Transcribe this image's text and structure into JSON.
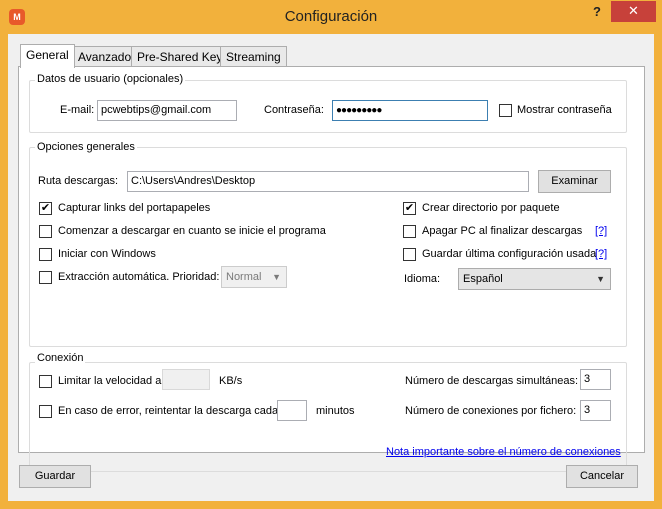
{
  "window": {
    "title": "Configuración",
    "app_icon": "M",
    "help_label": "?",
    "close_label": "✕"
  },
  "tabs": [
    {
      "label": "General"
    },
    {
      "label": "Avanzado"
    },
    {
      "label": "Pre-Shared Keys"
    },
    {
      "label": "Streaming"
    }
  ],
  "user": {
    "legend": "Datos de usuario (opcionales)",
    "email_label": "E-mail:",
    "email_value": "pcwebtips@gmail.com",
    "password_label": "Contraseña:",
    "password_value": "●●●●●●●●●",
    "show_password_label": "Mostrar contraseña"
  },
  "general": {
    "legend": "Opciones generales",
    "download_path_label": "Ruta descargas:",
    "download_path_value": "C:\\Users\\Andres\\Desktop",
    "browse_label": "Examinar",
    "capture_label": "Capturar links del portapapeles",
    "start_label": "Comenzar a descargar en cuanto se inicie el programa",
    "windows_label": "Iniciar con Windows",
    "extract_label": "Extracción automática. Prioridad:",
    "priority_value": "Normal",
    "create_dir_label": "Crear directorio por paquete",
    "shutdown_label": "Apagar PC al finalizar descargas",
    "save_config_label": "Guardar última configuración usada",
    "help_link": "[?]",
    "language_label": "Idioma:",
    "language_value": "Español"
  },
  "connection": {
    "legend": "Conexión",
    "limit_label": "Limitar la velocidad a",
    "speed_unit": "KB/s",
    "retry_label": "En caso de error, reintentar la descarga cada",
    "retry_unit": "minutos",
    "simultaneous_label": "Número de descargas simultáneas:",
    "simultaneous_value": "3",
    "per_file_label": "Número de conexiones por fichero:",
    "per_file_value": "3",
    "note_link": "Nota importante sobre el número de conexiones"
  },
  "footer": {
    "save_label": "Guardar",
    "cancel_label": "Cancelar"
  },
  "checkbox_states": {
    "show_password": false,
    "capture": true,
    "start": false,
    "windows": false,
    "extract": false,
    "create_dir": true,
    "shutdown": false,
    "save_config": false,
    "limit": false,
    "retry": false
  }
}
